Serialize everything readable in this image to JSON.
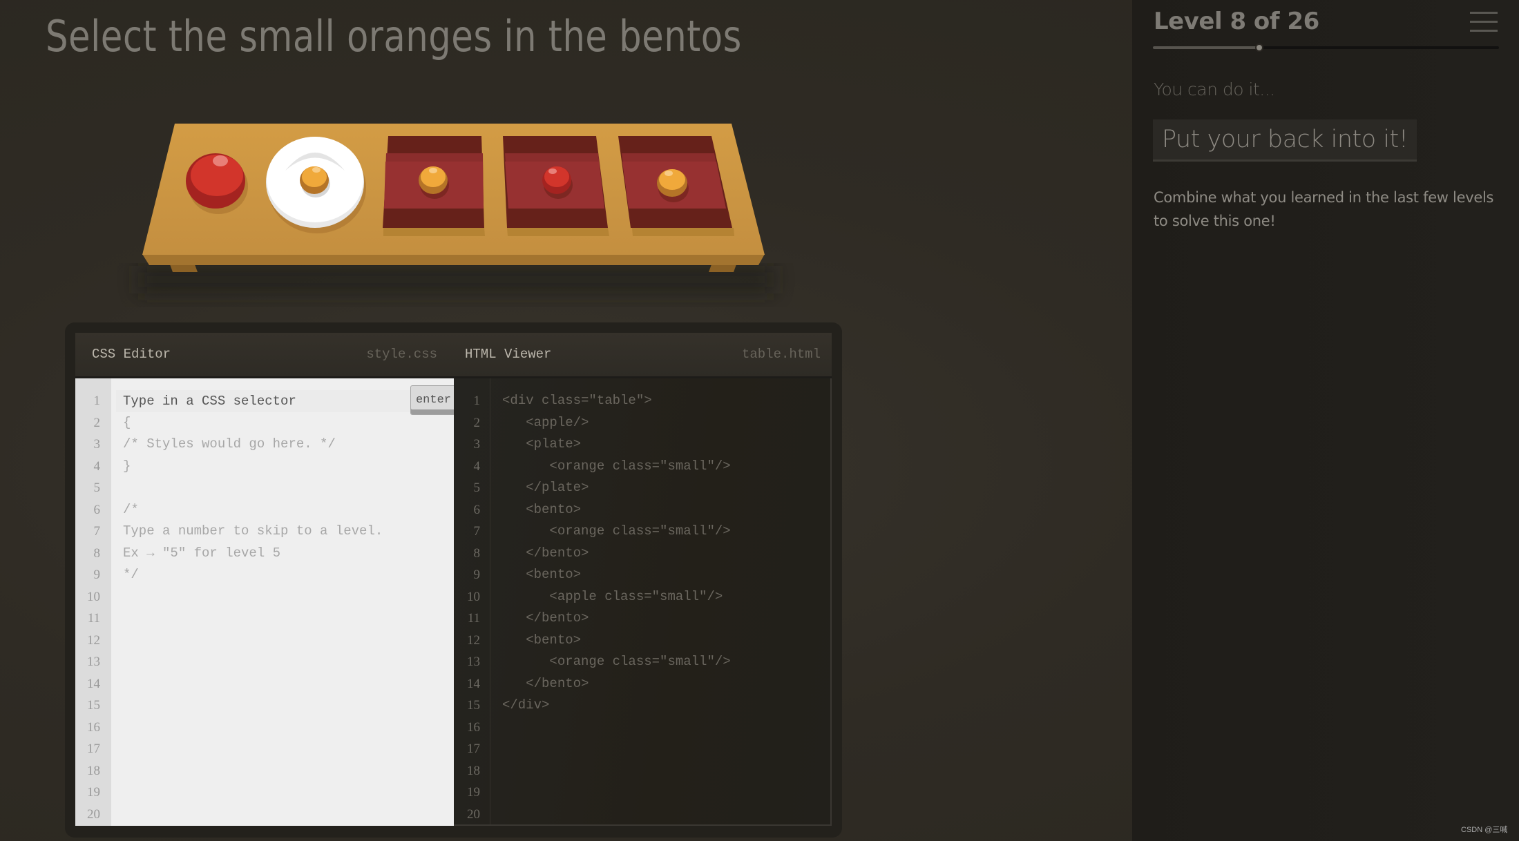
{
  "instruction": "Select the small oranges in the bentos",
  "scene": {
    "items": [
      {
        "type": "apple",
        "size": "normal",
        "container": null
      },
      {
        "type": "plate",
        "contains": {
          "type": "orange",
          "size": "small"
        }
      },
      {
        "type": "bento",
        "contains": {
          "type": "orange",
          "size": "small"
        }
      },
      {
        "type": "bento",
        "contains": {
          "type": "apple",
          "size": "small"
        }
      },
      {
        "type": "bento",
        "contains": {
          "type": "orange",
          "size": "small"
        }
      }
    ],
    "colors": {
      "table": "#cf9a45",
      "apple": "#d03a2b",
      "orange": "#f0a93b",
      "plate": "#ffffff",
      "bento": "#973131"
    }
  },
  "css_editor": {
    "title": "CSS Editor",
    "filename": "style.css",
    "enter_label": "enter",
    "input_placeholder": "Type in a CSS selector",
    "input_value": "",
    "lines": [
      "",
      "{",
      "/* Styles would go here. */",
      "}",
      "",
      "/*",
      "Type a number to skip to a level.",
      "Ex → \"5\" for level 5",
      "*/",
      "",
      "",
      "",
      "",
      "",
      "",
      "",
      "",
      "",
      "",
      ""
    ],
    "line_numbers": [
      "1",
      "2",
      "3",
      "4",
      "5",
      "6",
      "7",
      "8",
      "9",
      "10",
      "11",
      "12",
      "13",
      "14",
      "15",
      "16",
      "17",
      "18",
      "19",
      "20"
    ]
  },
  "html_viewer": {
    "title": "HTML Viewer",
    "filename": "table.html",
    "lines": [
      "<div class=\"table\">",
      "   <apple/>",
      "   <plate>",
      "      <orange class=\"small\"/>",
      "   </plate>",
      "   <bento>",
      "      <orange class=\"small\"/>",
      "   </bento>",
      "   <bento>",
      "      <apple class=\"small\"/>",
      "   </bento>",
      "   <bento>",
      "      <orange class=\"small\"/>",
      "   </bento>",
      "</div>",
      "",
      "",
      "",
      "",
      ""
    ],
    "line_numbers": [
      "1",
      "2",
      "3",
      "4",
      "5",
      "6",
      "7",
      "8",
      "9",
      "10",
      "11",
      "12",
      "13",
      "14",
      "15",
      "16",
      "17",
      "18",
      "19",
      "20"
    ]
  },
  "sidebar": {
    "level_title": "Level 8 of 26",
    "current_level": 8,
    "total_levels": 26,
    "progress_fraction": 0.308,
    "hint_label": "You can do it...",
    "hint_title": "Put your back into it!",
    "description": "Combine what you learned in the last few levels to solve this one!",
    "menu_icon": "hamburger-menu-icon"
  },
  "watermark": "CSDN @三喊"
}
